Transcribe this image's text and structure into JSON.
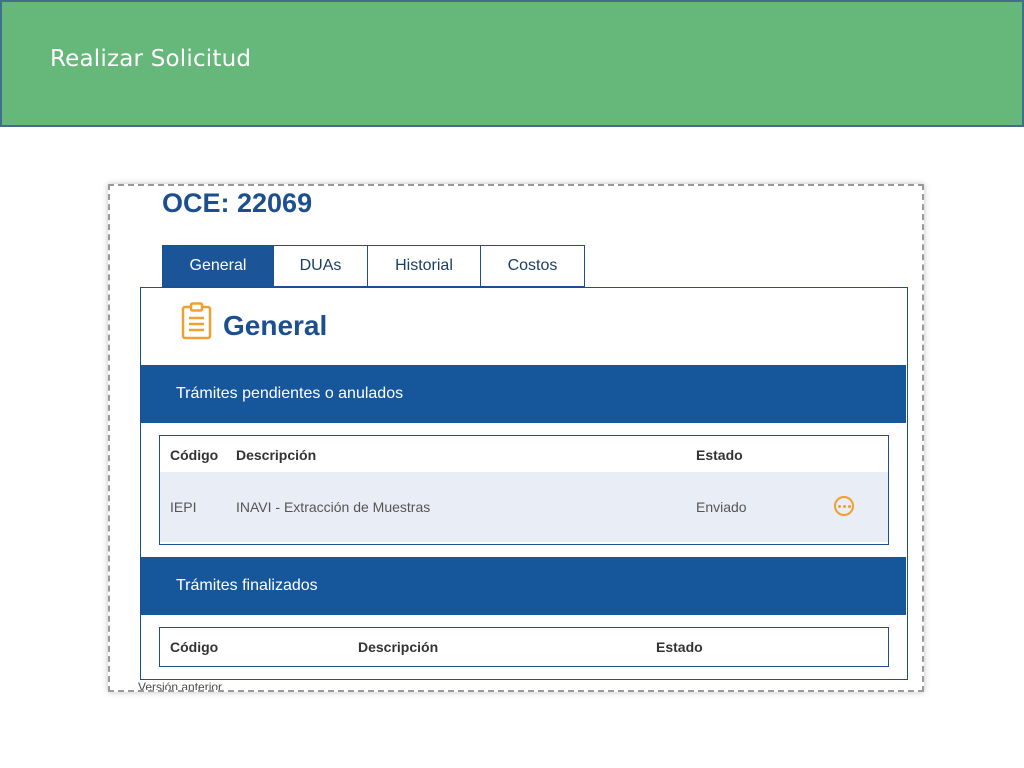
{
  "banner": {
    "title": "Realizar Solicitud"
  },
  "page": {
    "title": "OCE: 22069"
  },
  "tabs": [
    {
      "label": "General",
      "active": true
    },
    {
      "label": "DUAs",
      "active": false
    },
    {
      "label": "Historial",
      "active": false
    },
    {
      "label": "Costos",
      "active": false
    }
  ],
  "general": {
    "title": "General",
    "icon": "clipboard-icon"
  },
  "pending": {
    "heading": "Trámites pendientes o anulados",
    "columns": {
      "code": "Código",
      "description": "Descripción",
      "status": "Estado"
    },
    "rows": [
      {
        "code": "IEPI",
        "description": "INAVI - Extracción de Muestras",
        "status": "Enviado",
        "action_icon": "more-options-icon"
      }
    ]
  },
  "finished": {
    "heading": "Trámites finalizados",
    "columns": {
      "code": "Código",
      "description": "Descripción",
      "status": "Estado"
    }
  },
  "footer": {
    "previous_version": "Versión anterior"
  },
  "colors": {
    "banner_bg": "#66b77a",
    "primary_blue": "#1c5597",
    "section_bar": "#16579b",
    "accent_orange": "#f0a030",
    "row_bg": "#e9edf5"
  }
}
